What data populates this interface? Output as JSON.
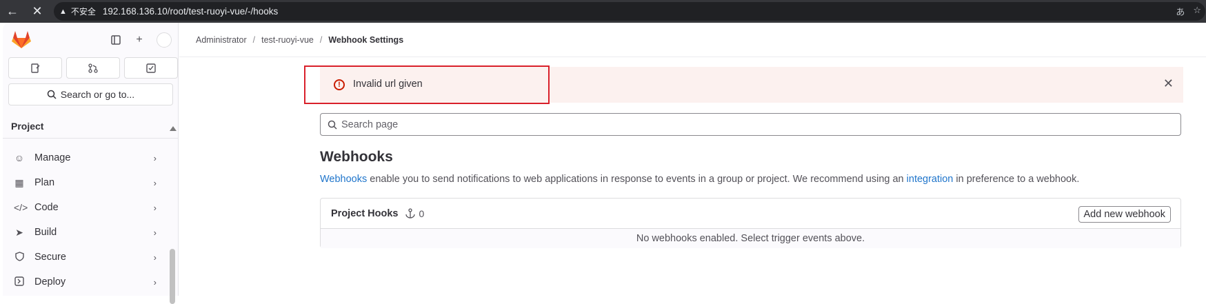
{
  "browser": {
    "insecure_label": "不安全",
    "url": "192.168.136.10/root/test-ruoyi-vue/-/hooks"
  },
  "sidebar": {
    "search_label": "Search or go to...",
    "section_title": "Project",
    "items": [
      {
        "label": "Manage",
        "icon": "users-icon"
      },
      {
        "label": "Plan",
        "icon": "calendar-icon"
      },
      {
        "label": "Code",
        "icon": "code-icon"
      },
      {
        "label": "Build",
        "icon": "rocket-icon"
      },
      {
        "label": "Secure",
        "icon": "shield-icon"
      },
      {
        "label": "Deploy",
        "icon": "deploy-icon"
      }
    ]
  },
  "breadcrumb": {
    "items": [
      "Administrator",
      "test-ruoyi-vue"
    ],
    "current": "Webhook Settings"
  },
  "alert": {
    "text": "Invalid url given",
    "color": "#c91c00"
  },
  "page_search": {
    "placeholder": "Search page"
  },
  "webhooks": {
    "title": "Webhooks",
    "desc_link1": "Webhooks",
    "desc_mid": " enable you to send notifications to web applications in response to events in a group or project. We recommend using an ",
    "desc_link2": "integration",
    "desc_end": " in preference to a webhook.",
    "card_title": "Project Hooks",
    "hook_count": "0",
    "add_button": "Add new webhook",
    "empty_text": "No webhooks enabled. Select trigger events above."
  },
  "colors": {
    "link": "#1f75cb",
    "alert_bg": "#fcf1ef",
    "highlight": "#d9202a"
  }
}
